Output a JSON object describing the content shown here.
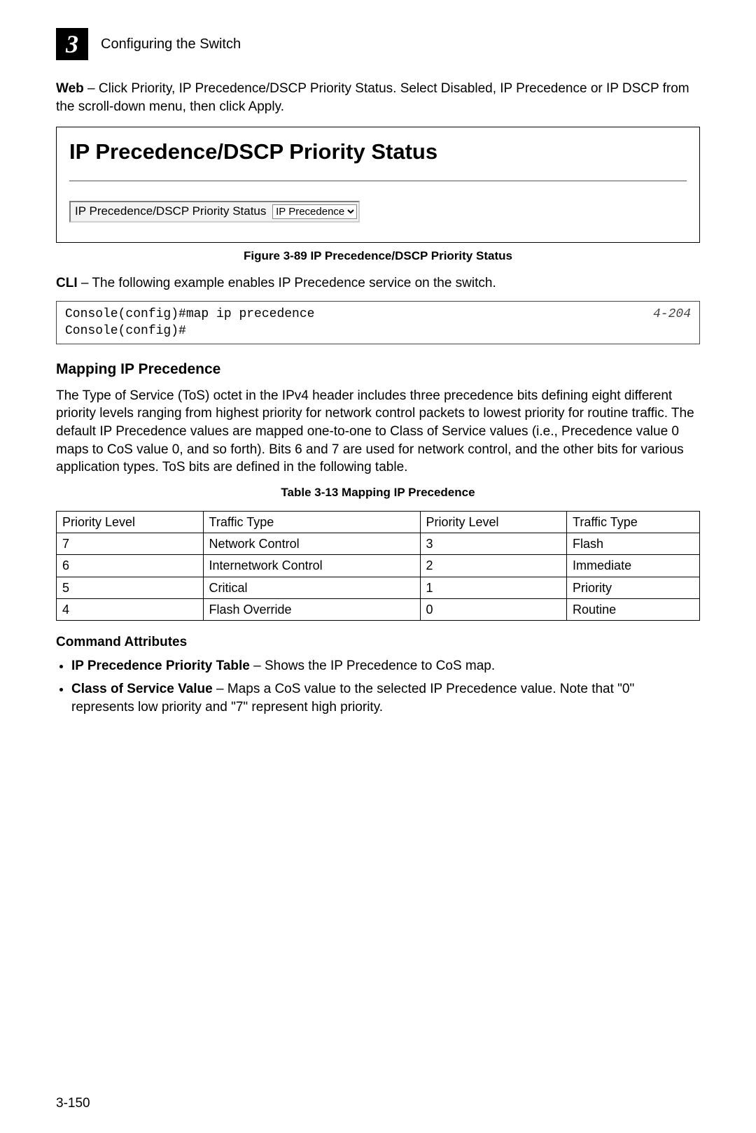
{
  "header": {
    "chapter_number": "3",
    "chapter_title": "Configuring the Switch"
  },
  "web_intro": {
    "lead": "Web",
    "body": " – Click Priority, IP Precedence/DSCP Priority Status. Select Disabled, IP Precedence or IP DSCP from the scroll-down menu, then click Apply."
  },
  "screenshot": {
    "title": "IP Precedence/DSCP Priority Status",
    "label": "IP Precedence/DSCP Priority Status",
    "selected": "IP Precedence",
    "options": [
      "Disabled",
      "IP Precedence",
      "IP DSCP"
    ]
  },
  "figure_caption": "Figure 3-89  IP Precedence/DSCP Priority Status",
  "cli_intro": {
    "lead": "CLI",
    "body": " – The following example enables IP Precedence service on the switch."
  },
  "cli": {
    "lines": "Console(config)#map ip precedence\nConsole(config)#",
    "ref": "4-204"
  },
  "section_title": "Mapping IP Precedence",
  "section_body": "The Type of Service (ToS) octet in the IPv4 header includes three precedence bits defining eight different priority levels ranging from highest priority for network control packets to lowest priority for routine traffic. The default IP Precedence values are mapped one-to-one to Class of Service values (i.e., Precedence value 0 maps to CoS value 0, and so forth). Bits 6 and 7 are used for network control, and the other bits for various application types. ToS bits are defined in the following table.",
  "table_caption": "Table 3-13  Mapping IP Precedence",
  "table": {
    "headers": [
      "Priority Level",
      "Traffic Type",
      "Priority Level",
      "Traffic Type"
    ],
    "rows": [
      [
        "7",
        "Network Control",
        "3",
        "Flash"
      ],
      [
        "6",
        "Internetwork Control",
        "2",
        "Immediate"
      ],
      [
        "5",
        "Critical",
        "1",
        "Priority"
      ],
      [
        "4",
        "Flash Override",
        "0",
        "Routine"
      ]
    ]
  },
  "cmd_attr_title": "Command Attributes",
  "bullets": [
    {
      "lead": "IP Precedence Priority Table",
      "body": " – Shows the IP Precedence to CoS map."
    },
    {
      "lead": "Class of Service Value",
      "body": " – Maps a CoS value to the selected IP Precedence value. Note that \"0\" represents low priority and \"7\" represent high priority."
    }
  ],
  "page_number": "3-150",
  "chart_data": {
    "type": "table",
    "title": "Mapping IP Precedence",
    "columns": [
      "Priority Level",
      "Traffic Type"
    ],
    "rows": [
      {
        "Priority Level": 7,
        "Traffic Type": "Network Control"
      },
      {
        "Priority Level": 6,
        "Traffic Type": "Internetwork Control"
      },
      {
        "Priority Level": 5,
        "Traffic Type": "Critical"
      },
      {
        "Priority Level": 4,
        "Traffic Type": "Flash Override"
      },
      {
        "Priority Level": 3,
        "Traffic Type": "Flash"
      },
      {
        "Priority Level": 2,
        "Traffic Type": "Immediate"
      },
      {
        "Priority Level": 1,
        "Traffic Type": "Priority"
      },
      {
        "Priority Level": 0,
        "Traffic Type": "Routine"
      }
    ]
  }
}
